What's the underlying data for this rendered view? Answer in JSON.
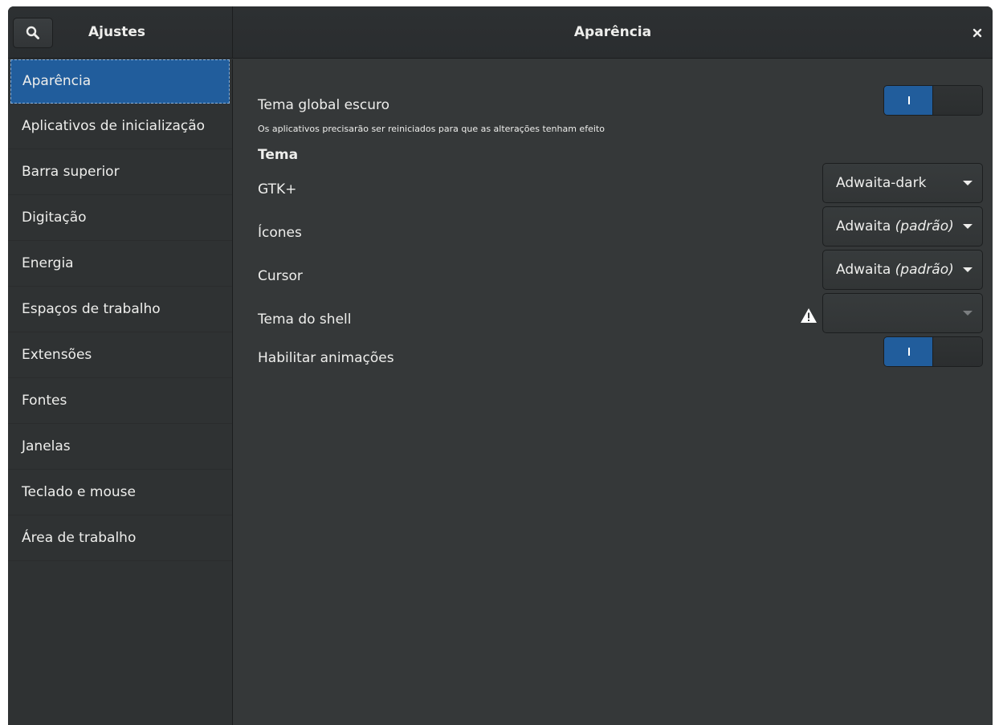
{
  "header": {
    "left_title": "Ajustes",
    "title": "Aparência",
    "search_icon": "search-icon",
    "close_icon": "close-icon"
  },
  "sidebar": {
    "items": [
      {
        "label": "Aparência",
        "selected": true
      },
      {
        "label": "Aplicativos de inicialização"
      },
      {
        "label": "Barra superior"
      },
      {
        "label": "Digitação"
      },
      {
        "label": "Energia"
      },
      {
        "label": "Espaços de trabalho"
      },
      {
        "label": "Extensões"
      },
      {
        "label": "Fontes"
      },
      {
        "label": "Janelas"
      },
      {
        "label": "Teclado e mouse"
      },
      {
        "label": "Área de trabalho"
      }
    ]
  },
  "content": {
    "dark_theme": {
      "label": "Tema global escuro",
      "subtitle": "Os aplicativos precisarão ser reiniciados para que as alterações tenham efeito",
      "enabled": true
    },
    "theme_section": "Tema",
    "gtk": {
      "label": "GTK+",
      "value": "Adwaita-dark"
    },
    "icons": {
      "label": "Ícones",
      "value": "Adwaita",
      "suffix": "(padrão)"
    },
    "cursor": {
      "label": "Cursor",
      "value": "Adwaita",
      "suffix": "(padrão)"
    },
    "shell_theme": {
      "label": "Tema do shell",
      "value": "",
      "warning_icon": "warning-icon"
    },
    "animations": {
      "label": "Habilitar animações",
      "enabled": true
    }
  },
  "colors": {
    "accent": "#215d9c",
    "background": "#353839",
    "sidebar": "#2f3233",
    "text": "#eeeeec"
  }
}
